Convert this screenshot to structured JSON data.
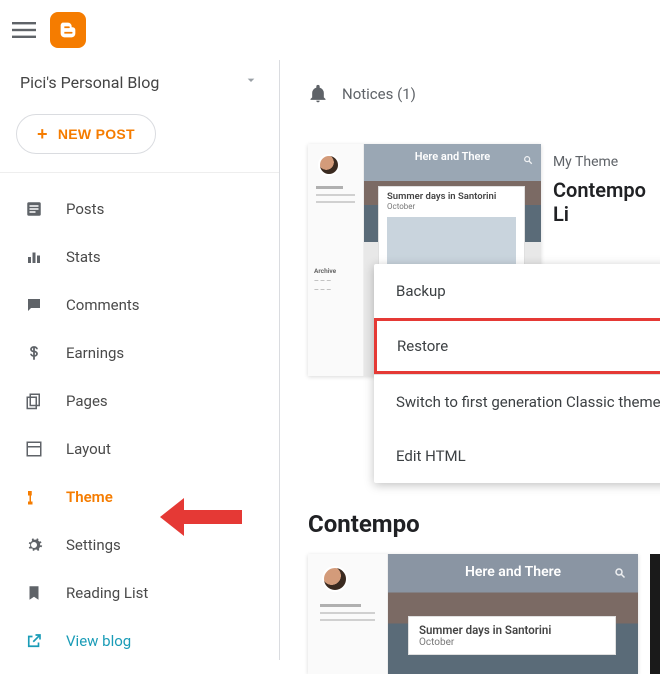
{
  "colors": {
    "accent": "#f57c00",
    "highlight": "#e53935",
    "link": "#1a9cb7"
  },
  "blog_name": "Pici's Personal Blog",
  "new_post": "NEW POST",
  "notices": {
    "label": "Notices (1)"
  },
  "nav": {
    "posts": "Posts",
    "stats": "Stats",
    "comments": "Comments",
    "earnings": "Earnings",
    "pages": "Pages",
    "layout": "Layout",
    "theme": "Theme",
    "settings": "Settings",
    "reading_list": "Reading List",
    "view_blog": "View blog"
  },
  "my_theme": {
    "caption": "My Theme",
    "name": "Contempo Li"
  },
  "menu": {
    "backup": "Backup",
    "restore": "Restore",
    "switch": "Switch to first generation Classic theme",
    "edit_html": "Edit HTML"
  },
  "section_heading": "Contempo",
  "preview": {
    "site_title": "Here and There",
    "post_title": "Summer days in Santorini",
    "archive_label": "Archive"
  }
}
